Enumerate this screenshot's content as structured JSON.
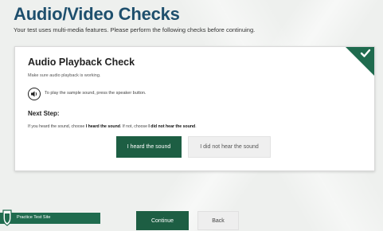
{
  "page": {
    "title": "Audio/Video Checks",
    "subtitle": "Your test uses multi-media features. Please perform the following checks before continuing."
  },
  "card": {
    "title": "Audio Playback Check",
    "description": "Make sure audio playback is working.",
    "speaker_instruction": "To play the sample sound, press the speaker button.",
    "next_step_heading": "Next Step:",
    "instruction_part1": "If you heard the sound, choose ",
    "instruction_bold1": "I heard the sound",
    "instruction_part2": ". If not, choose ",
    "instruction_bold2": "I did not hear the sound",
    "instruction_part3": ".",
    "heard_button": "I heard the sound",
    "not_heard_button": "I did not hear the sound",
    "status_icon": "checkmark-icon"
  },
  "footer": {
    "site_label": "Practice Test Site",
    "continue_button": "Continue",
    "back_button": "Back"
  },
  "colors": {
    "title": "#1e4f6d",
    "primary_green": "#1d5e43",
    "corner_green": "#1f6b4e",
    "secondary_button": "#efefef"
  }
}
